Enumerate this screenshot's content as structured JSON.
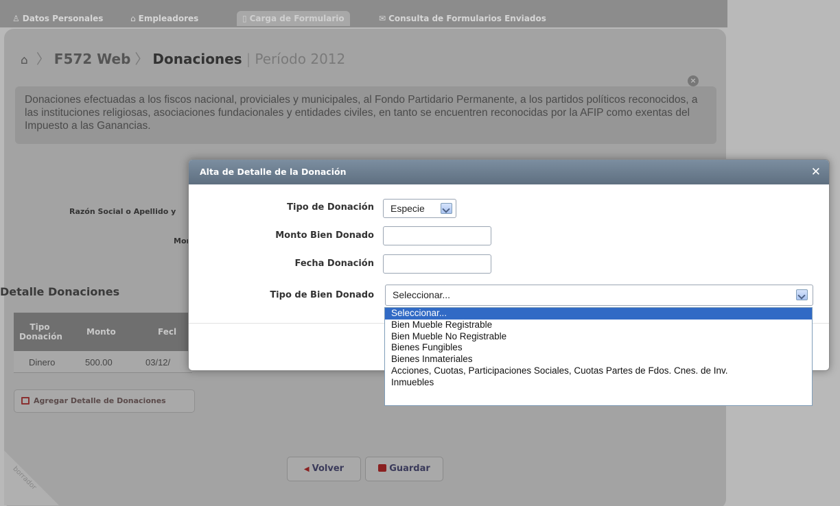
{
  "nav": {
    "tabs": [
      {
        "label": "Datos Personales"
      },
      {
        "label": "Empleadores"
      },
      {
        "label": "Carga de Formulario"
      },
      {
        "label": "Consulta de Formularios Enviados"
      }
    ]
  },
  "breadcrumb": {
    "app": "F572 Web",
    "section": "Donaciones",
    "period": "Período 2012"
  },
  "info_text": "Donaciones efectuadas a los fiscos nacional, proviciales y municipales, al Fondo Partidario Permanente, a los partidos políticos reconocidos, a las instituciones religiosas, asociaciones fundacionales y entidades civiles, en tanto se encuentren reconocidas por la AFIP como exentas del Impuesto a las Ganancias.",
  "background_form": {
    "razon_label": "Razón Social o Apellido y",
    "monto_label": "Mor"
  },
  "detalle": {
    "title": "Detalle Donaciones",
    "columns": [
      "Tipo Donación",
      "Monto",
      "Fecl"
    ],
    "rows": [
      {
        "tipo": "Dinero",
        "monto": "500.00",
        "fecha": "03/12/"
      }
    ],
    "add_button": "Agregar Detalle de Donaciones"
  },
  "footer_buttons": {
    "volver": "Volver",
    "guardar": "Guardar"
  },
  "watermark": "borrador",
  "modal": {
    "title": "Alta de Detalle de la Donación",
    "fields": {
      "tipo_donacion": {
        "label": "Tipo de Donación",
        "value": "Especie"
      },
      "monto_bien": {
        "label": "Monto Bien Donado",
        "value": ""
      },
      "fecha_donacion": {
        "label": "Fecha Donación",
        "value": ""
      },
      "tipo_bien": {
        "label": "Tipo de Bien Donado",
        "value": "Seleccionar..."
      }
    },
    "dropdown_options": [
      "Seleccionar...",
      "Bien Mueble Registrable",
      "Bien Mueble No Registrable",
      "Bienes Fungibles",
      "Bienes Inmateriales",
      "Acciones, Cuotas, Participaciones Sociales, Cuotas Partes de Fdos. Cnes. de Inv.",
      "Inmuebles"
    ]
  },
  "colors": {
    "modal_header": "#6b7c8d",
    "selected_option": "#316ac5",
    "overlay": "#b9b9b9"
  }
}
